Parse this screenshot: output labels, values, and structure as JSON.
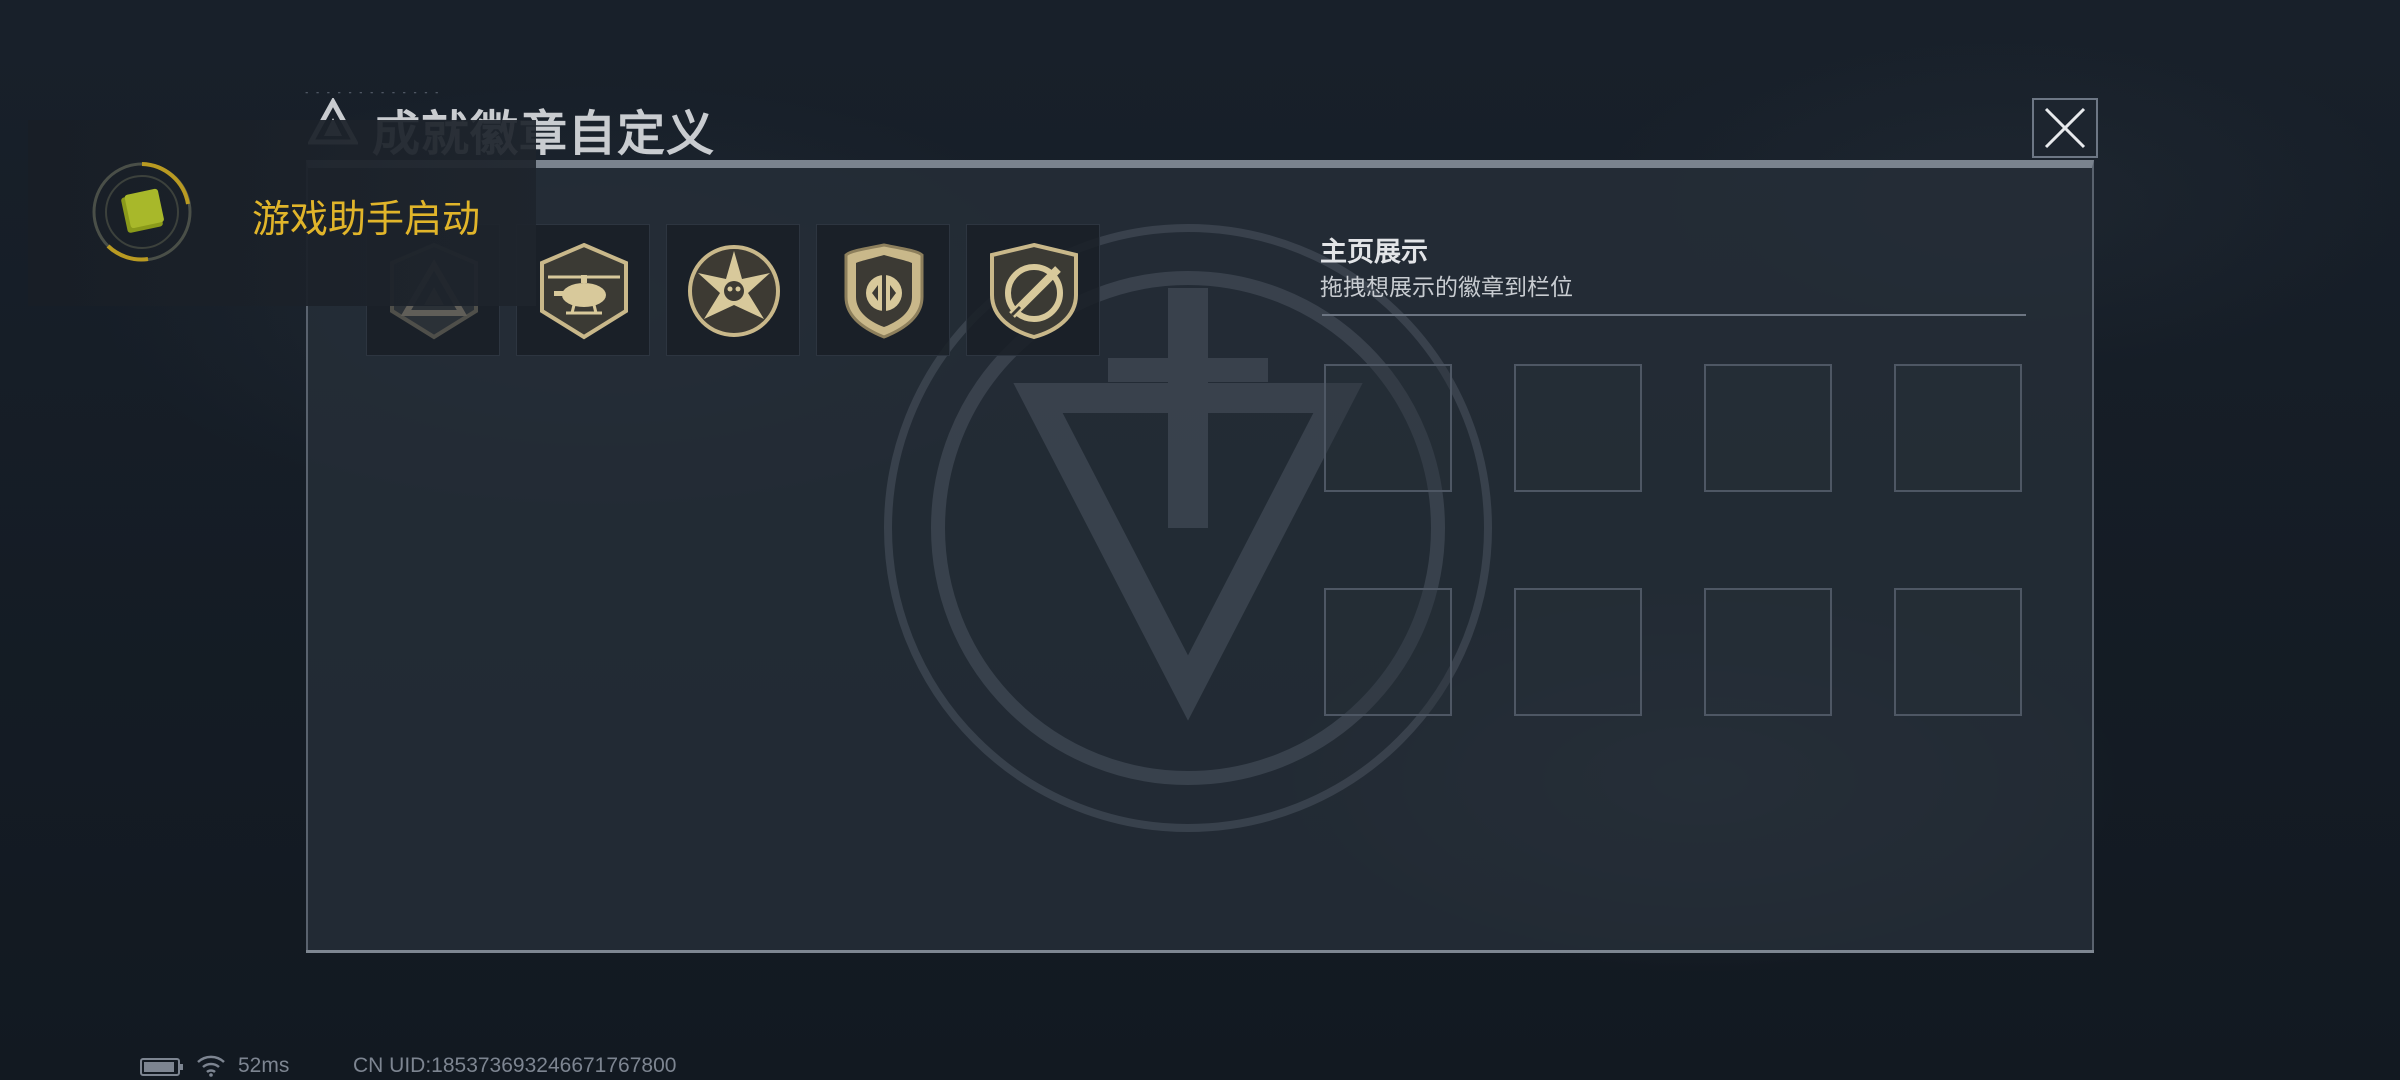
{
  "window": {
    "title": "成就徽章自定义",
    "title_watermark": "..."
  },
  "toast": {
    "text": "游戏助手启动",
    "accent": "#e1b52a"
  },
  "badges": [
    {
      "icon": "triangle-emblem-badge-icon",
      "dimmed": true
    },
    {
      "icon": "helicopter-badge-icon",
      "dimmed": false
    },
    {
      "icon": "star-skull-badge-icon",
      "dimmed": false
    },
    {
      "icon": "shield-crest-badge-icon",
      "dimmed": false
    },
    {
      "icon": "knife-shield-badge-icon",
      "dimmed": false
    }
  ],
  "display": {
    "title": "主页展示",
    "subtitle": "拖拽想展示的徽章到栏位",
    "slot_count": 8
  },
  "status": {
    "ping": "52ms",
    "uid": "CN UID:1853736932466717678​00"
  },
  "colors": {
    "background": "#141b24",
    "panel": "#262e38",
    "badge_gold": "#c9b88a"
  }
}
